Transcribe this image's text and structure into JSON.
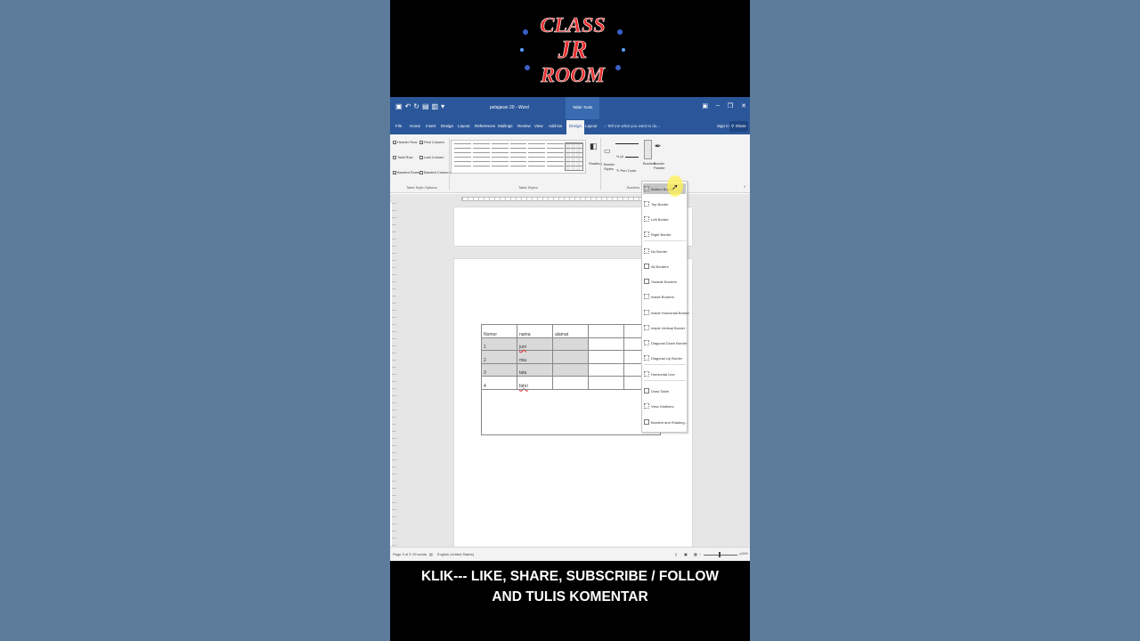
{
  "logo": {
    "line1": "CLASS",
    "line2": "JR",
    "line3": "ROOM"
  },
  "word": {
    "doc_title": "pelajaran 20 - Word",
    "context_tab": "Table Tools",
    "tabs": [
      "File",
      "Home",
      "Insert",
      "Design",
      "Layout",
      "References",
      "Mailings",
      "Review",
      "View",
      "Add-ins",
      "Design",
      "Layout"
    ],
    "active_tab_index": 10,
    "tell_me": "Tell me what you want to do...",
    "sign_in": "Sign in",
    "share": "Share",
    "style_options": {
      "header_row": "Header Row",
      "first_column": "First Column",
      "total_row": "Total Row",
      "last_column": "Last Column",
      "banded_rows": "Banded Rows",
      "banded_columns": "Banded Columns",
      "group_label": "Table Style Options"
    },
    "table_styles_label": "Table Styles",
    "shading_label": "Shading",
    "border_styles_label": "Border Styles",
    "weight": "½ pt",
    "pen_color": "Pen Color",
    "borders_label": "Borders",
    "border_painter_label": "Border Painter",
    "borders_group_label": "Borders",
    "table": {
      "rows": [
        [
          "Nomor",
          "nama",
          "alamat",
          "",
          ""
        ],
        [
          "1",
          "juni",
          "",
          "",
          ""
        ],
        [
          "2",
          "mia",
          "",
          "",
          ""
        ],
        [
          "3",
          "tata",
          "",
          "",
          ""
        ],
        [
          "4",
          "fahri",
          "",
          "",
          ""
        ]
      ]
    },
    "border_menu": [
      "Bottom Border",
      "Top Border",
      "Left Border",
      "Right Border",
      "No Border",
      "All Borders",
      "Outside Borders",
      "Inside Borders",
      "Inside Horizontal Border",
      "Inside Vertical Border",
      "Diagonal Down Border",
      "Diagonal Up Border",
      "Horizontal Line",
      "Draw Table",
      "View Gridlines",
      "Borders and Shading..."
    ],
    "status": {
      "page": "Page 3 of 3",
      "words": "29 words",
      "language": "English (United States)",
      "zoom": "100%"
    }
  },
  "caption": {
    "line1": "KLIK--- LIKE, SHARE, SUBSCRIBE / FOLLOW",
    "line2": "AND TULIS KOMENTAR"
  }
}
